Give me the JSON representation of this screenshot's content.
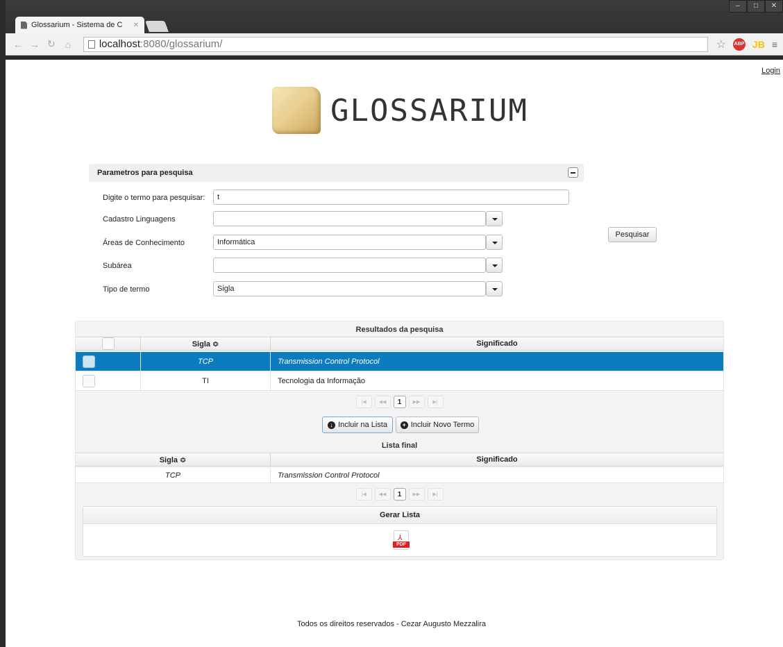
{
  "browser": {
    "tab_title": "Glossarium - Sistema de C",
    "url_host": "localhost",
    "url_path": ":8080/glossarium/",
    "abp_label": "ABP",
    "jb_label": "JB"
  },
  "header": {
    "login": "Login",
    "logo_text": "GLOSSARIUM"
  },
  "search_panel": {
    "title": "Parametros para pesquisa",
    "term_label": "Digite o termo para pesquisar:",
    "term_value": "t",
    "languages_label": "Cadastro Linguagens",
    "languages_value": "",
    "areas_label": "Áreas de Conhecimento",
    "areas_value": "Informática",
    "subarea_label": "Subárea",
    "subarea_value": "",
    "type_label": "Tipo de termo",
    "type_value": "Sigla",
    "search_button": "Pesquisar"
  },
  "results": {
    "title": "Resultados da pesquisa",
    "col_sigla": "Sigla ≎",
    "col_significado": "Significado",
    "rows": [
      {
        "sigla": "TCP",
        "significado": "Transmission Control Protocol",
        "selected": true
      },
      {
        "sigla": "TI",
        "significado": "Tecnologia da Informação",
        "selected": false
      }
    ],
    "page": "1",
    "include_list_button": "Incluir na Lista",
    "include_new_button": "Incluir Novo Termo"
  },
  "final_list": {
    "title": "Lista final",
    "col_sigla": "Sigla ≎",
    "col_significado": "Significado",
    "rows": [
      {
        "sigla": "TCP",
        "significado": "Transmission Control Protocol"
      }
    ],
    "page": "1"
  },
  "generate": {
    "title": "Gerar Lista",
    "pdf_label": "PDF"
  },
  "footer": {
    "text": "Todos os direitos reservados - Cezar Augusto Mezzalira"
  },
  "colors": {
    "selected_row": "#0b7dbf"
  }
}
